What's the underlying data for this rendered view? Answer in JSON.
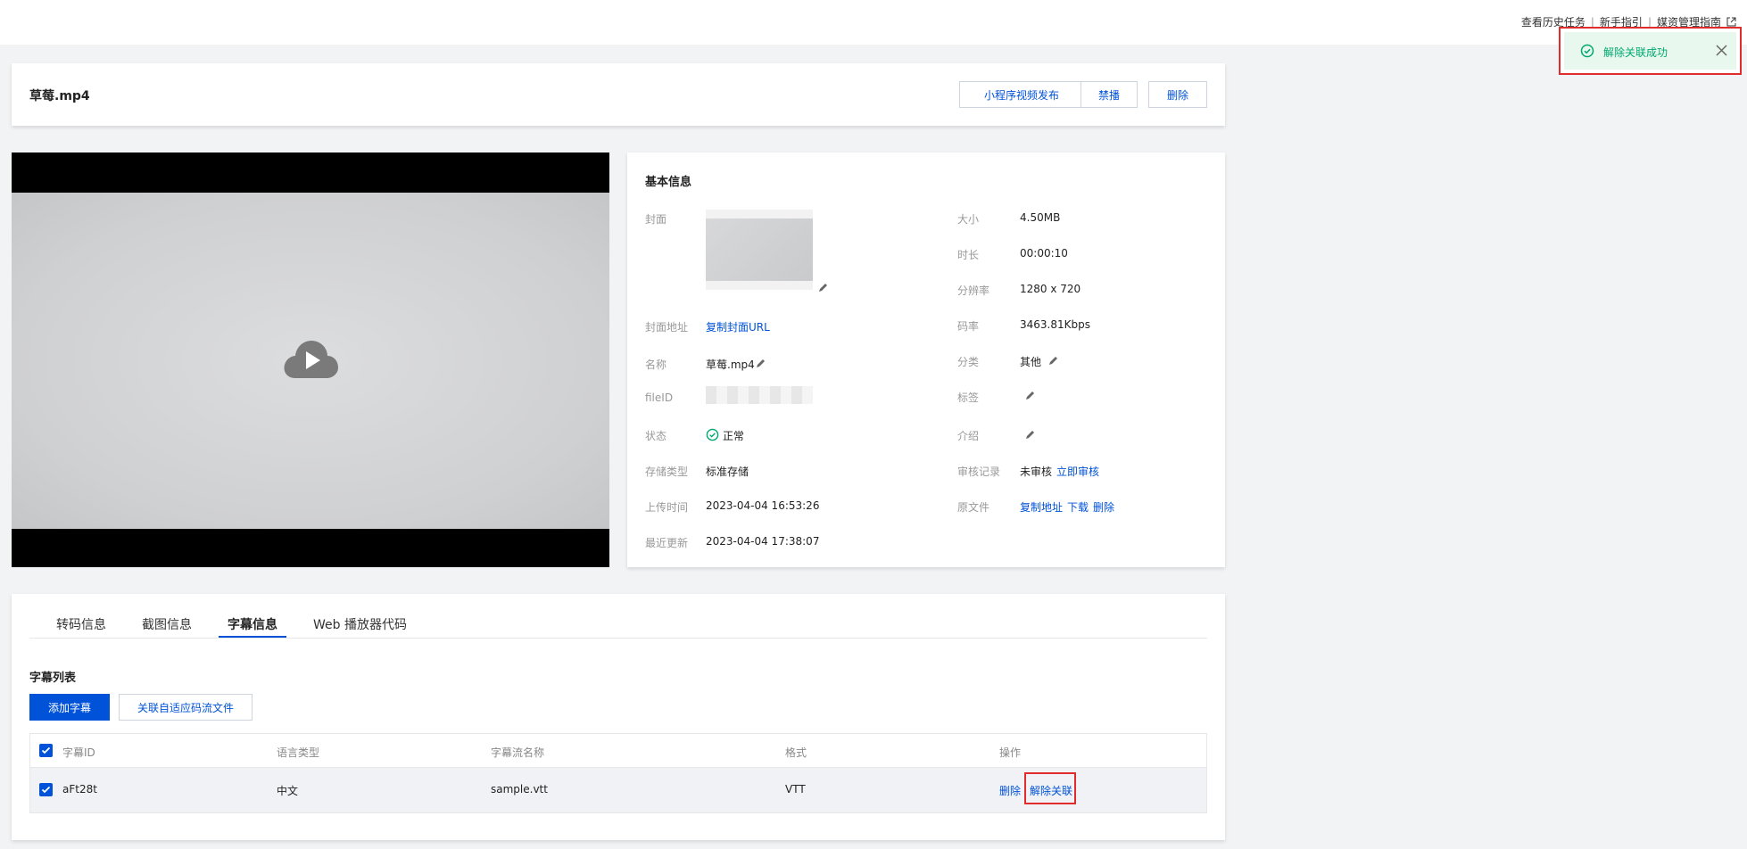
{
  "top_links": {
    "history": "查看历史任务",
    "sep": "|",
    "guide": "新手指引",
    "media_guide": "媒资管理指南"
  },
  "toast": {
    "message": "解除关联成功",
    "status_color": "#00a870"
  },
  "header": {
    "title": "草莓.mp4",
    "buttons": {
      "publish": "小程序视频发布",
      "ban": "禁播",
      "delete": "删除"
    }
  },
  "info": {
    "title": "基本信息",
    "left": {
      "cover_label": "封面",
      "cover_url_label": "封面地址",
      "cover_url_value": "复制封面URL",
      "name_label": "名称",
      "name_value": "草莓.mp4",
      "fileid_label": "fileID",
      "status_label": "状态",
      "status_value": "正常",
      "storage_label": "存储类型",
      "storage_value": "标准存储",
      "upload_label": "上传时间",
      "upload_value": "2023-04-04 16:53:26",
      "update_label": "最近更新",
      "update_value": "2023-04-04 17:38:07"
    },
    "right": {
      "size_label": "大小",
      "size_value": "4.50MB",
      "duration_label": "时长",
      "duration_value": "00:00:10",
      "resolution_label": "分辨率",
      "resolution_value": "1280 x 720",
      "bitrate_label": "码率",
      "bitrate_value": "3463.81Kbps",
      "category_label": "分类",
      "category_value": "其他",
      "tags_label": "标签",
      "intro_label": "介绍",
      "review_label": "审核记录",
      "review_value": "未审核",
      "review_action": "立即审核",
      "source_label": "原文件",
      "source_copy": "复制地址",
      "source_download": "下载",
      "source_delete": "删除"
    }
  },
  "tabs": [
    {
      "label": "转码信息"
    },
    {
      "label": "截图信息"
    },
    {
      "label": "字幕信息"
    },
    {
      "label": "Web 播放器代码"
    }
  ],
  "subtitles": {
    "section_title": "字幕列表",
    "add_button": "添加字幕",
    "link_button": "关联自适应码流文件",
    "columns": [
      "字幕ID",
      "语言类型",
      "字幕流名称",
      "格式",
      "操作"
    ],
    "rows": [
      {
        "id": "aFt28t",
        "language": "中文",
        "name": "sample.vtt",
        "format": "VTT",
        "action_delete": "删除",
        "action_unlink": "解除关联"
      }
    ]
  }
}
